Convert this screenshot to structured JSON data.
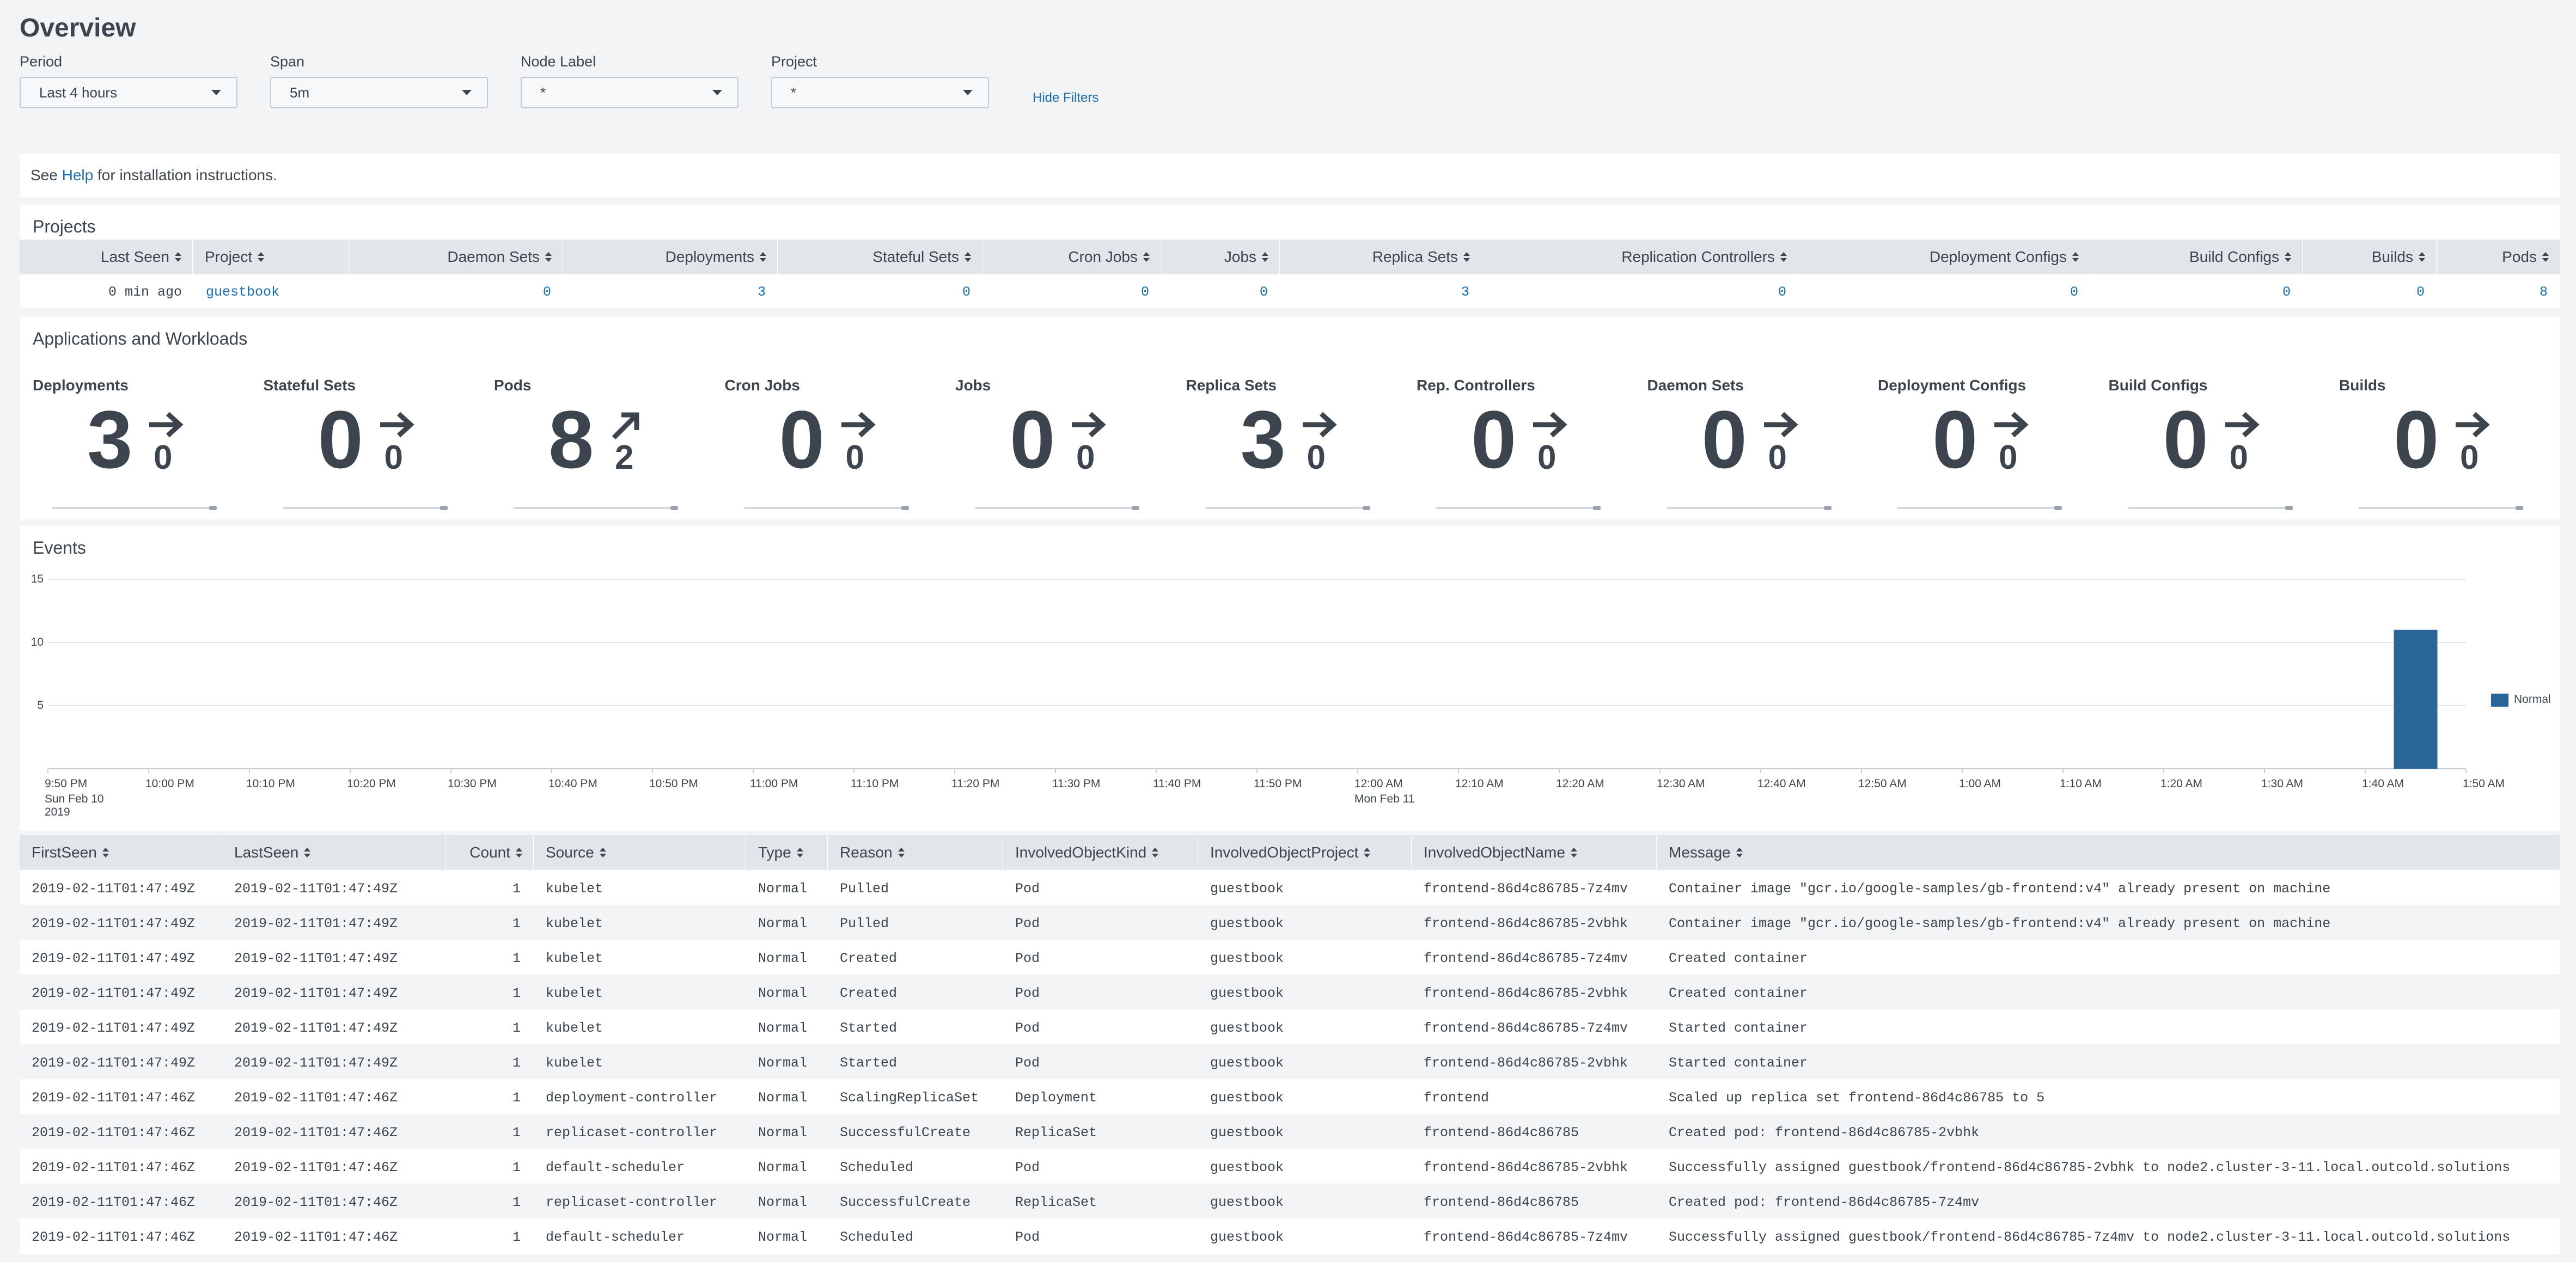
{
  "title": "Overview",
  "filters": [
    {
      "label": "Period",
      "value": "Last 4 hours"
    },
    {
      "label": "Span",
      "value": "5m"
    },
    {
      "label": "Node Label",
      "value": "*"
    },
    {
      "label": "Project",
      "value": "*"
    }
  ],
  "hide_filters": "Hide Filters",
  "help": {
    "prefix": "See ",
    "link": "Help",
    "suffix": " for installation instructions."
  },
  "projects": {
    "title": "Projects",
    "columns": [
      "Last Seen",
      "Project",
      "Daemon Sets",
      "Deployments",
      "Stateful Sets",
      "Cron Jobs",
      "Jobs",
      "Replica Sets",
      "Replication Controllers",
      "Deployment Configs",
      "Build Configs",
      "Builds",
      "Pods"
    ],
    "row": [
      "0 min ago",
      "guestbook",
      "0",
      "3",
      "0",
      "0",
      "0",
      "3",
      "0",
      "0",
      "0",
      "0",
      "8"
    ]
  },
  "apps": {
    "title": "Applications and Workloads",
    "items": [
      {
        "label": "Deployments",
        "value": "3",
        "delta": "0",
        "trend": "flat"
      },
      {
        "label": "Stateful Sets",
        "value": "0",
        "delta": "0",
        "trend": "flat"
      },
      {
        "label": "Pods",
        "value": "8",
        "delta": "2",
        "trend": "up"
      },
      {
        "label": "Cron Jobs",
        "value": "0",
        "delta": "0",
        "trend": "flat"
      },
      {
        "label": "Jobs",
        "value": "0",
        "delta": "0",
        "trend": "flat"
      },
      {
        "label": "Replica Sets",
        "value": "3",
        "delta": "0",
        "trend": "flat"
      },
      {
        "label": "Rep. Controllers",
        "value": "0",
        "delta": "0",
        "trend": "flat"
      },
      {
        "label": "Daemon Sets",
        "value": "0",
        "delta": "0",
        "trend": "flat"
      },
      {
        "label": "Deployment Configs",
        "value": "0",
        "delta": "0",
        "trend": "flat"
      },
      {
        "label": "Build Configs",
        "value": "0",
        "delta": "0",
        "trend": "flat"
      },
      {
        "label": "Builds",
        "value": "0",
        "delta": "0",
        "trend": "flat"
      }
    ]
  },
  "events_title": "Events",
  "chart_data": {
    "type": "bar",
    "x_ticks": [
      "9:50 PM",
      "10:00 PM",
      "10:10 PM",
      "10:20 PM",
      "10:30 PM",
      "10:40 PM",
      "10:50 PM",
      "11:00 PM",
      "11:10 PM",
      "11:20 PM",
      "11:30 PM",
      "11:40 PM",
      "11:50 PM",
      "12:00 AM",
      "12:10 AM",
      "12:20 AM",
      "12:30 AM",
      "12:40 AM",
      "12:50 AM",
      "1:00 AM",
      "1:10 AM",
      "1:20 AM",
      "1:30 AM",
      "1:40 AM",
      "1:50 AM"
    ],
    "x_sub_labels": [
      {
        "tick": "9:50 PM",
        "lines": [
          "Sun Feb 10",
          "2019"
        ]
      },
      {
        "tick": "12:00 AM",
        "lines": [
          "Mon Feb 11"
        ]
      }
    ],
    "y_ticks": [
      "15",
      "10",
      "5"
    ],
    "ylim": [
      0,
      15
    ],
    "series": [
      {
        "name": "Normal",
        "color": "#2a6597",
        "points": [
          {
            "x": "1:45 AM",
            "y": 11
          }
        ]
      }
    ],
    "legend": "right",
    "grid": true
  },
  "events": {
    "columns": [
      "FirstSeen",
      "LastSeen",
      "Count",
      "Source",
      "Type",
      "Reason",
      "InvolvedObjectKind",
      "InvolvedObjectProject",
      "InvolvedObjectName",
      "Message"
    ],
    "rows": [
      [
        "2019-02-11T01:47:49Z",
        "2019-02-11T01:47:49Z",
        "1",
        "kubelet",
        "Normal",
        "Pulled",
        "Pod",
        "guestbook",
        "frontend-86d4c86785-7z4mv",
        "Container image \"gcr.io/google-samples/gb-frontend:v4\" already present on machine"
      ],
      [
        "2019-02-11T01:47:49Z",
        "2019-02-11T01:47:49Z",
        "1",
        "kubelet",
        "Normal",
        "Pulled",
        "Pod",
        "guestbook",
        "frontend-86d4c86785-2vbhk",
        "Container image \"gcr.io/google-samples/gb-frontend:v4\" already present on machine"
      ],
      [
        "2019-02-11T01:47:49Z",
        "2019-02-11T01:47:49Z",
        "1",
        "kubelet",
        "Normal",
        "Created",
        "Pod",
        "guestbook",
        "frontend-86d4c86785-7z4mv",
        "Created container"
      ],
      [
        "2019-02-11T01:47:49Z",
        "2019-02-11T01:47:49Z",
        "1",
        "kubelet",
        "Normal",
        "Created",
        "Pod",
        "guestbook",
        "frontend-86d4c86785-2vbhk",
        "Created container"
      ],
      [
        "2019-02-11T01:47:49Z",
        "2019-02-11T01:47:49Z",
        "1",
        "kubelet",
        "Normal",
        "Started",
        "Pod",
        "guestbook",
        "frontend-86d4c86785-7z4mv",
        "Started container"
      ],
      [
        "2019-02-11T01:47:49Z",
        "2019-02-11T01:47:49Z",
        "1",
        "kubelet",
        "Normal",
        "Started",
        "Pod",
        "guestbook",
        "frontend-86d4c86785-2vbhk",
        "Started container"
      ],
      [
        "2019-02-11T01:47:46Z",
        "2019-02-11T01:47:46Z",
        "1",
        "deployment-controller",
        "Normal",
        "ScalingReplicaSet",
        "Deployment",
        "guestbook",
        "frontend",
        "Scaled up replica set frontend-86d4c86785 to 5"
      ],
      [
        "2019-02-11T01:47:46Z",
        "2019-02-11T01:47:46Z",
        "1",
        "replicaset-controller",
        "Normal",
        "SuccessfulCreate",
        "ReplicaSet",
        "guestbook",
        "frontend-86d4c86785",
        "Created pod: frontend-86d4c86785-2vbhk"
      ],
      [
        "2019-02-11T01:47:46Z",
        "2019-02-11T01:47:46Z",
        "1",
        "default-scheduler",
        "Normal",
        "Scheduled",
        "Pod",
        "guestbook",
        "frontend-86d4c86785-2vbhk",
        "Successfully assigned guestbook/frontend-86d4c86785-2vbhk to node2.cluster-3-11.local.outcold.solutions"
      ],
      [
        "2019-02-11T01:47:46Z",
        "2019-02-11T01:47:46Z",
        "1",
        "replicaset-controller",
        "Normal",
        "SuccessfulCreate",
        "ReplicaSet",
        "guestbook",
        "frontend-86d4c86785",
        "Created pod: frontend-86d4c86785-7z4mv"
      ],
      [
        "2019-02-11T01:47:46Z",
        "2019-02-11T01:47:46Z",
        "1",
        "default-scheduler",
        "Normal",
        "Scheduled",
        "Pod",
        "guestbook",
        "frontend-86d4c86785-7z4mv",
        "Successfully assigned guestbook/frontend-86d4c86785-7z4mv to node2.cluster-3-11.local.outcold.solutions"
      ]
    ]
  }
}
